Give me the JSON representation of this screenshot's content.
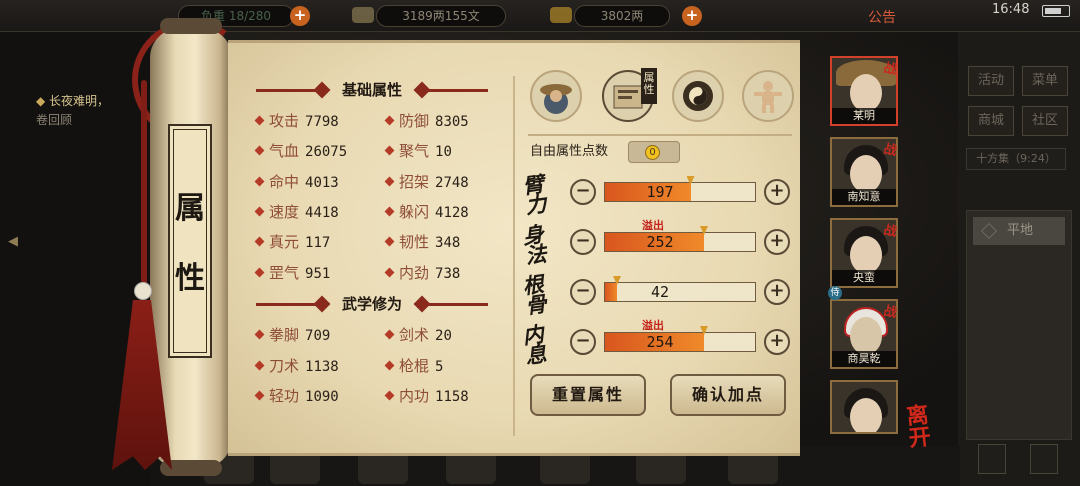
{
  "topbar": {
    "weight_label": "负重",
    "weight_value": "18/280",
    "money_value": "3189两155文",
    "gold_value": "3802两",
    "notice": "公告",
    "time": "16:48"
  },
  "left_news": {
    "line1": "长夜难明，",
    "line2": "卷回顾"
  },
  "scroll_title": "属性",
  "basic_section_title": "基础属性",
  "basic_attrs": [
    {
      "name": "攻击",
      "value": "7798"
    },
    {
      "name": "防御",
      "value": "8305"
    },
    {
      "name": "气血",
      "value": "26075"
    },
    {
      "name": "聚气",
      "value": "10"
    },
    {
      "name": "命中",
      "value": "4013"
    },
    {
      "name": "招架",
      "value": "2748"
    },
    {
      "name": "速度",
      "value": "4418"
    },
    {
      "name": "躲闪",
      "value": "4128"
    },
    {
      "name": "真元",
      "value": "117"
    },
    {
      "name": "韧性",
      "value": "348"
    },
    {
      "name": "罡气",
      "value": "951"
    },
    {
      "name": "内劲",
      "value": "738"
    }
  ],
  "martial_section_title": "武学修为",
  "martial_attrs": [
    {
      "name": "拳脚",
      "value": "709"
    },
    {
      "name": "剑术",
      "value": "20"
    },
    {
      "name": "刀术",
      "value": "1138"
    },
    {
      "name": "枪棍",
      "value": "5"
    },
    {
      "name": "轻功",
      "value": "1090"
    },
    {
      "name": "内功",
      "value": "1158"
    }
  ],
  "tabs": {
    "active_label": "属性",
    "icons": [
      "character-tab-icon",
      "attribute-tab-icon",
      "bagua-tab-icon",
      "meridian-tab-icon"
    ]
  },
  "free_points": {
    "label": "自由属性点数",
    "value": "0"
  },
  "stats": [
    {
      "name": "臂力",
      "value": "197",
      "fill": 0.57,
      "overflow": ""
    },
    {
      "name": "身法",
      "value": "252",
      "fill": 0.66,
      "overflow": "溢出"
    },
    {
      "name": "根骨",
      "value": "42",
      "fill": 0.08,
      "overflow": ""
    },
    {
      "name": "内息",
      "value": "254",
      "fill": 0.66,
      "overflow": "溢出"
    }
  ],
  "buttons": {
    "reset": "重置属性",
    "confirm": "确认加点"
  },
  "party": [
    {
      "name": "某明",
      "tag": "战",
      "selected": true
    },
    {
      "name": "南知意",
      "tag": "战",
      "selected": false
    },
    {
      "name": "央蛮",
      "tag": "战",
      "selected": false
    },
    {
      "name": "商昊乾",
      "tag": "战",
      "selected": false
    },
    {
      "name": "",
      "tag": "",
      "selected": false
    }
  ],
  "leave_label": "离开",
  "right_menu": {
    "activity": "活动",
    "menu": "菜单",
    "shop": "商城",
    "community": "社区",
    "location": "十方集（9:24）",
    "terrain": "平地"
  },
  "colors": {
    "accent_red": "#8a2a1d",
    "bar_orange": "#e06a22",
    "paper": "#ecdfbc"
  }
}
